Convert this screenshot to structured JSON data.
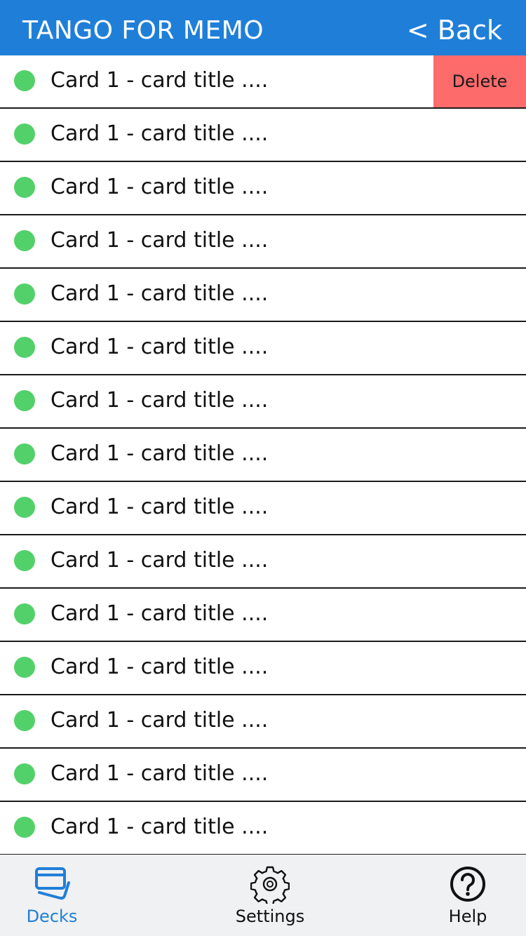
{
  "header": {
    "title": "TANGO FOR MEMO",
    "back_label": "< Back"
  },
  "list": {
    "items": [
      {
        "label": "Card 1 - card title ...."
      },
      {
        "label": "Card 1 - card title ...."
      },
      {
        "label": "Card 1 - card title ...."
      },
      {
        "label": "Card 1 - card title ...."
      },
      {
        "label": "Card 1 - card title ...."
      },
      {
        "label": "Card 1 - card title ...."
      },
      {
        "label": "Card 1 - card title ...."
      },
      {
        "label": "Card 1 - card title ...."
      },
      {
        "label": "Card 1 - card title ...."
      },
      {
        "label": "Card 1 - card title ...."
      },
      {
        "label": "Card 1 - card title ...."
      },
      {
        "label": "Card 1 - card title ...."
      },
      {
        "label": "Card 1 - card title ...."
      },
      {
        "label": "Card 1 - card title ...."
      },
      {
        "label": "Card 1 - card title ...."
      }
    ],
    "delete_label": "Delete",
    "status_color": "#52d16a"
  },
  "tabs": [
    {
      "label": "Decks",
      "icon": "decks-icon",
      "active": true
    },
    {
      "label": "Settings",
      "icon": "gear-icon",
      "active": false
    },
    {
      "label": "Help",
      "icon": "help-icon",
      "active": false
    }
  ],
  "colors": {
    "accent": "#1f7fd8",
    "delete": "#fe6b6b"
  }
}
